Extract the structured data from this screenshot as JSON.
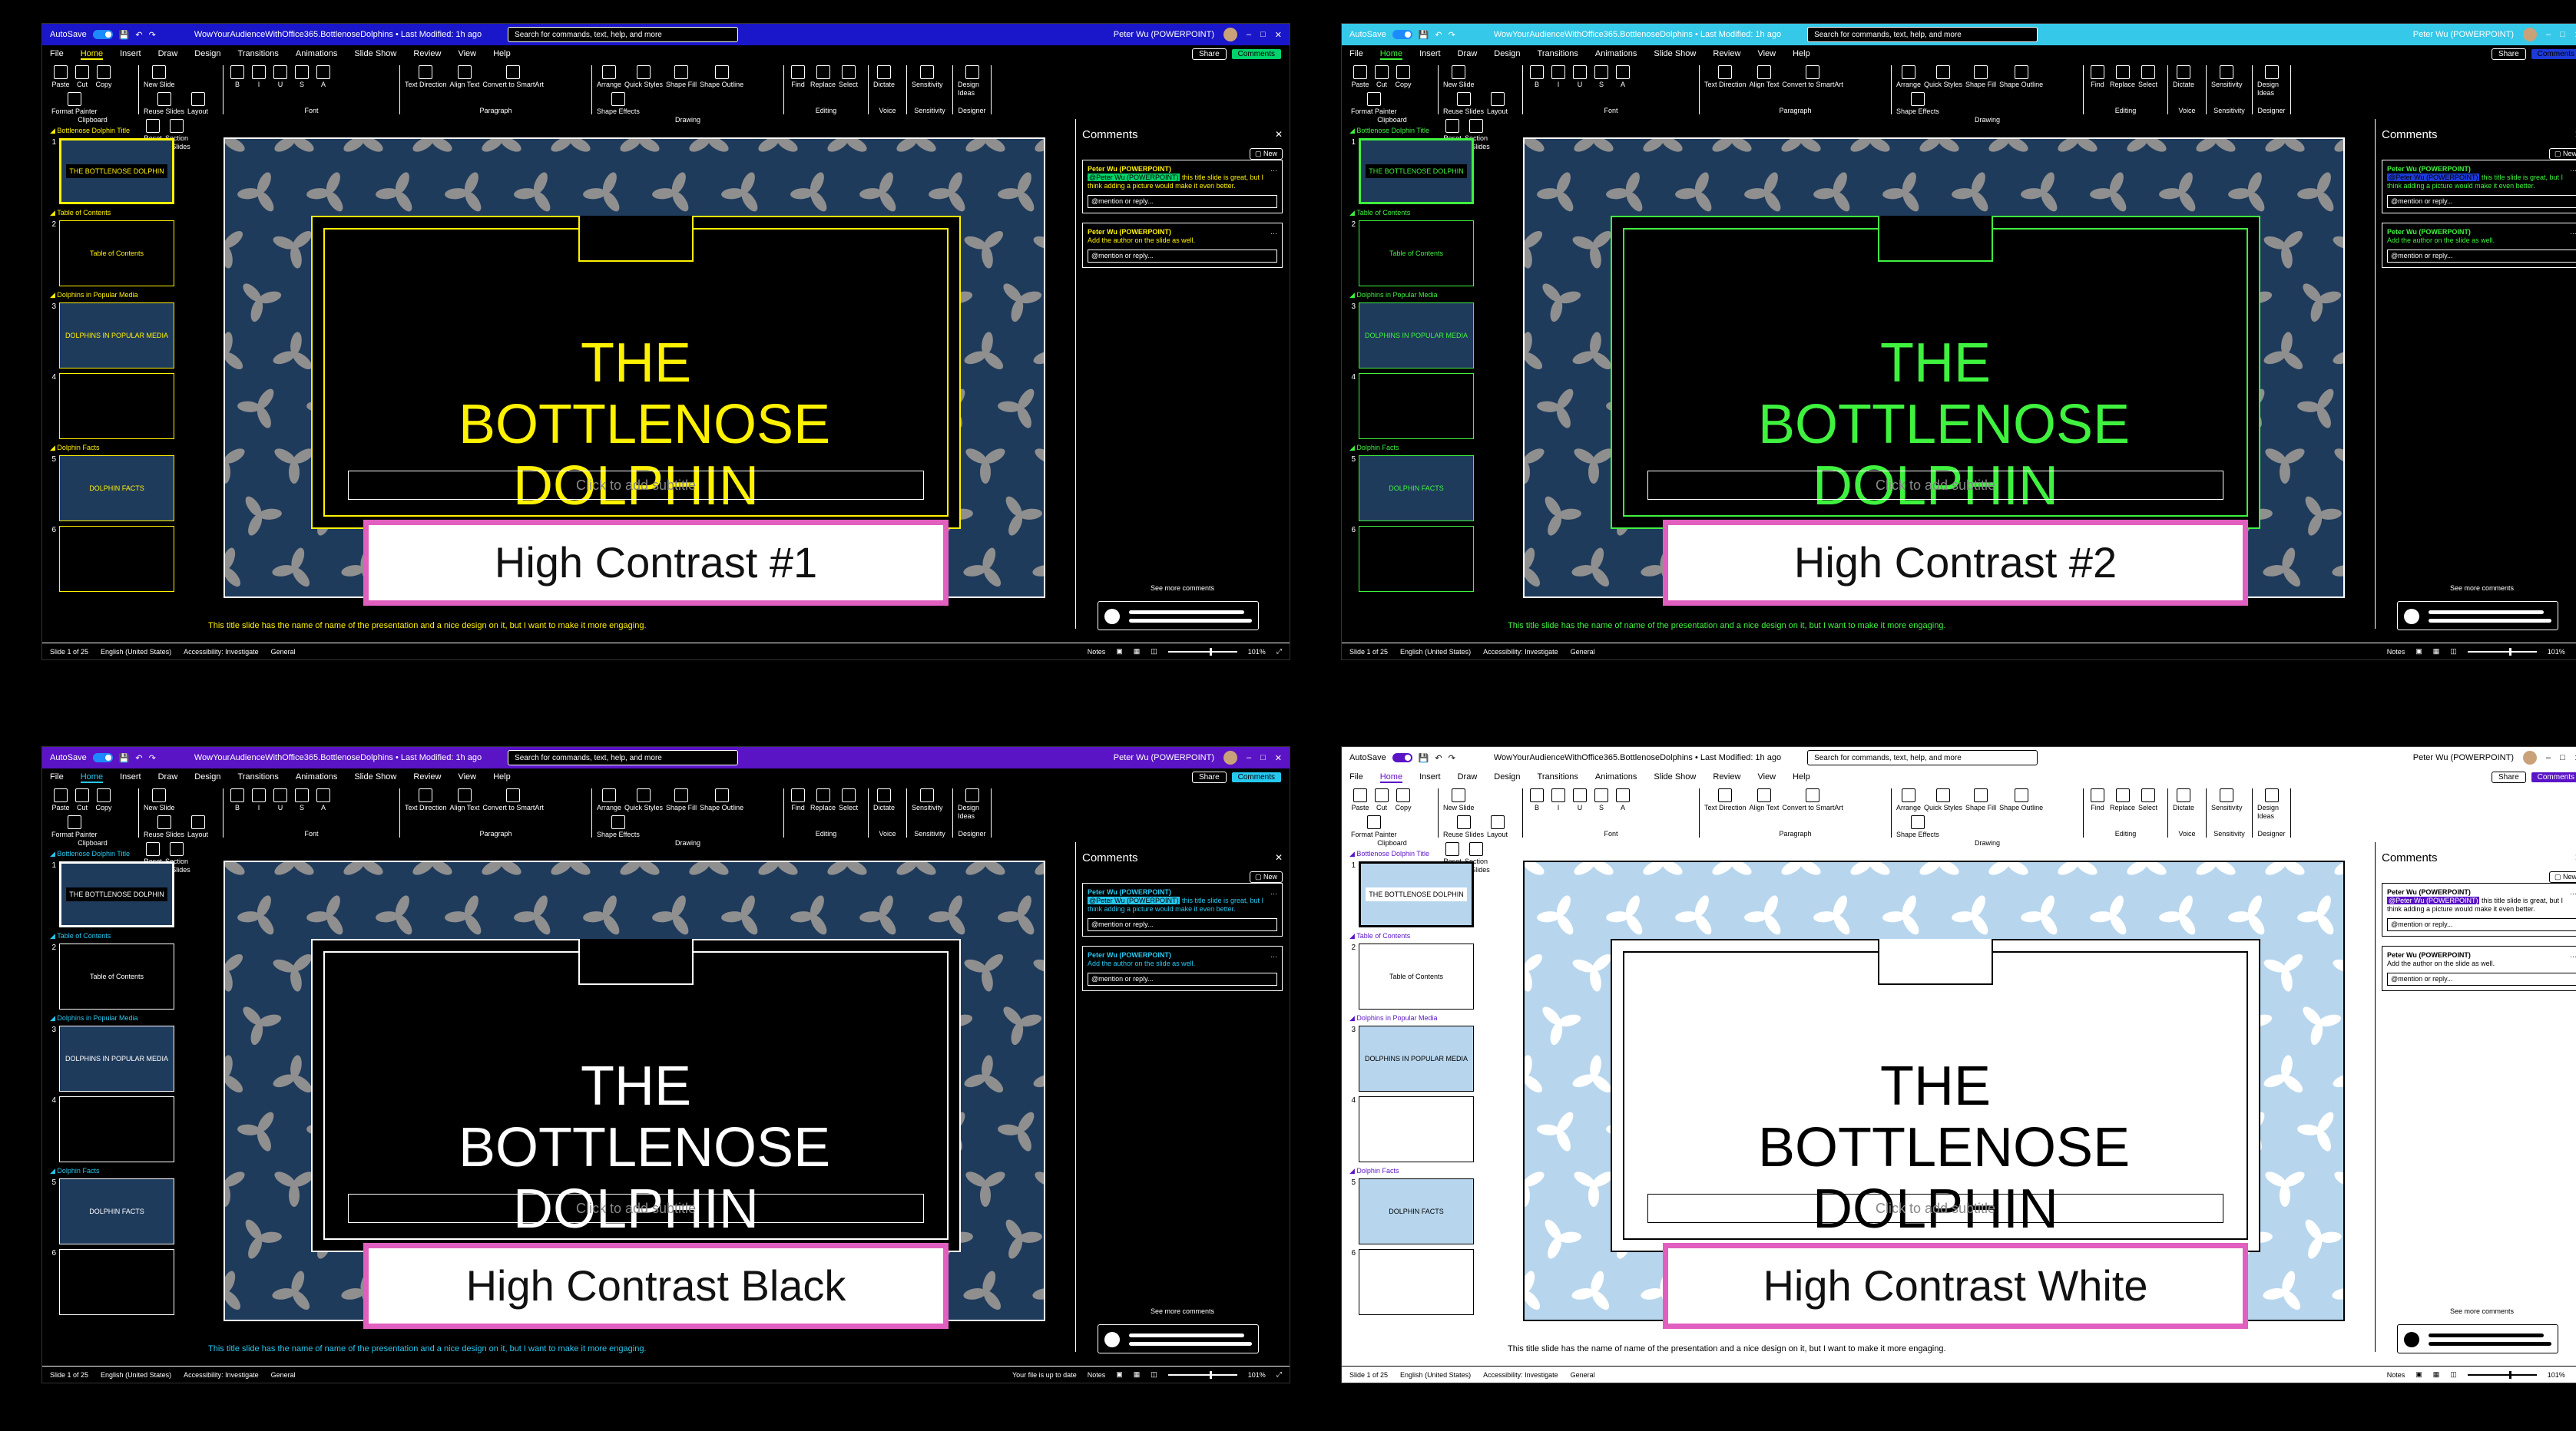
{
  "common": {
    "autosave_label": "AutoSave",
    "autosave_state": "On",
    "filename": "WowYourAudienceWithOffice365.BottlenoseDolphins",
    "last_modified": "Last Modified: 1h ago",
    "search_placeholder": "Search for commands, text, help, and more",
    "user_name": "Peter Wu (POWERPOINT)",
    "menu_tabs": [
      "File",
      "Home",
      "Insert",
      "Draw",
      "Design",
      "Transitions",
      "Animations",
      "Slide Show",
      "Review",
      "View",
      "Help"
    ],
    "share_label": "Share",
    "comments_label": "Comments",
    "ribbon_groups": [
      {
        "label": "Clipboard",
        "controls": [
          "Paste",
          "Cut",
          "Copy",
          "Format Painter"
        ]
      },
      {
        "label": "Slides",
        "controls": [
          "New Slide",
          "Reuse Slides",
          "Layout",
          "Reset",
          "Section"
        ]
      },
      {
        "label": "Font",
        "controls": [
          "B",
          "I",
          "U",
          "S",
          "A"
        ]
      },
      {
        "label": "Paragraph",
        "controls": [
          "Text Direction",
          "Align Text",
          "Convert to SmartArt"
        ]
      },
      {
        "label": "Drawing",
        "controls": [
          "Arrange",
          "Quick Styles",
          "Shape Fill",
          "Shape Outline",
          "Shape Effects"
        ]
      },
      {
        "label": "Editing",
        "controls": [
          "Find",
          "Replace",
          "Select"
        ]
      },
      {
        "label": "Voice",
        "controls": [
          "Dictate"
        ]
      },
      {
        "label": "Sensitivity",
        "controls": [
          "Sensitivity"
        ]
      },
      {
        "label": "Designer",
        "controls": [
          "Design Ideas"
        ]
      }
    ],
    "sections": [
      {
        "name": "Bottlenose Dolphin Title",
        "slides": [
          {
            "num": "1",
            "text": "THE BOTTLENOSE DOLPHIN"
          }
        ]
      },
      {
        "name": "Table of Contents",
        "slides": [
          {
            "num": "2",
            "text": "Table of Contents"
          }
        ]
      },
      {
        "name": "Dolphins in Popular Media",
        "slides": [
          {
            "num": "3",
            "text": "DOLPHINS IN POPULAR MEDIA"
          },
          {
            "num": "4",
            "text": ""
          }
        ]
      },
      {
        "name": "Dolphin Facts",
        "slides": [
          {
            "num": "5",
            "text": "DOLPHIN FACTS"
          },
          {
            "num": "6",
            "text": ""
          }
        ]
      }
    ],
    "slide_title": "THE BOTTLENOSE DOLPHIN",
    "slide_subtitle": "Click to add subtitle",
    "notes": "This title slide has the name of name of the presentation and a nice design on it, but I want to make it more engaging.",
    "comments_title": "Comments",
    "new_label": "New",
    "comments": [
      {
        "author": "Peter Wu (POWERPOINT)",
        "mention": "@Peter Wu (POWERPOINT)",
        "text": "this title slide is great, but I think adding a picture would make it even better.",
        "reply_placeholder": "@mention or reply..."
      },
      {
        "author": "Peter Wu (POWERPOINT)",
        "mention": "",
        "text": "Add the author on the slide as well.",
        "reply_placeholder": "@mention or reply..."
      }
    ],
    "see_more": "See more comments",
    "status_slide": "Slide 1 of 25",
    "status_lang": "English (United States)",
    "status_access": "Accessibility: Investigate",
    "status_general": "General",
    "status_notes": "Notes",
    "status_zoom": "101%"
  },
  "panels": [
    {
      "id": "p1",
      "caption": "High Contrast #1",
      "theme": {
        "titlebar": "#1a16c9",
        "bg": "#000000",
        "fg": "#ffffff",
        "accent": "#fff200",
        "title": "#fff200",
        "border": "#fff200",
        "search": "#000000",
        "highlight": "#00d36b",
        "pattern_bg": "#1f3b5c",
        "pattern_leaf": "#8f8f8f",
        "tbox_bg": "#000000"
      },
      "status_extra": ""
    },
    {
      "id": "p2",
      "caption": "High Contrast #2",
      "theme": {
        "titlebar": "#35c8e9",
        "bg": "#000000",
        "fg": "#ffffff",
        "accent": "#3ff23f",
        "title": "#3ff23f",
        "border": "#3ff23f",
        "search": "#000000",
        "highlight": "#1d3bd9",
        "pattern_bg": "#1f3b5c",
        "pattern_leaf": "#8f8f8f",
        "tbox_bg": "#000000"
      },
      "status_extra": ""
    },
    {
      "id": "p3",
      "caption": "High Contrast Black",
      "theme": {
        "titlebar": "#5a14c6",
        "bg": "#000000",
        "fg": "#ffffff",
        "accent": "#27c8f0",
        "title": "#ffffff",
        "border": "#ffffff",
        "search": "#000000",
        "highlight": "#27c8f0",
        "pattern_bg": "#1f3b5c",
        "pattern_leaf": "#8f8f8f",
        "tbox_bg": "#000000"
      },
      "status_extra": "Your file is up to date"
    },
    {
      "id": "p4",
      "caption": "High Contrast White",
      "theme": {
        "titlebar": "#ffffff",
        "bg": "#ffffff",
        "fg": "#000000",
        "accent": "#5a14c6",
        "title": "#000000",
        "border": "#000000",
        "search": "#ffffff",
        "highlight": "#5a14c6",
        "pattern_bg": "#b7d6ee",
        "pattern_leaf": "#ffffff",
        "tbox_bg": "#ffffff"
      },
      "status_extra": ""
    }
  ]
}
